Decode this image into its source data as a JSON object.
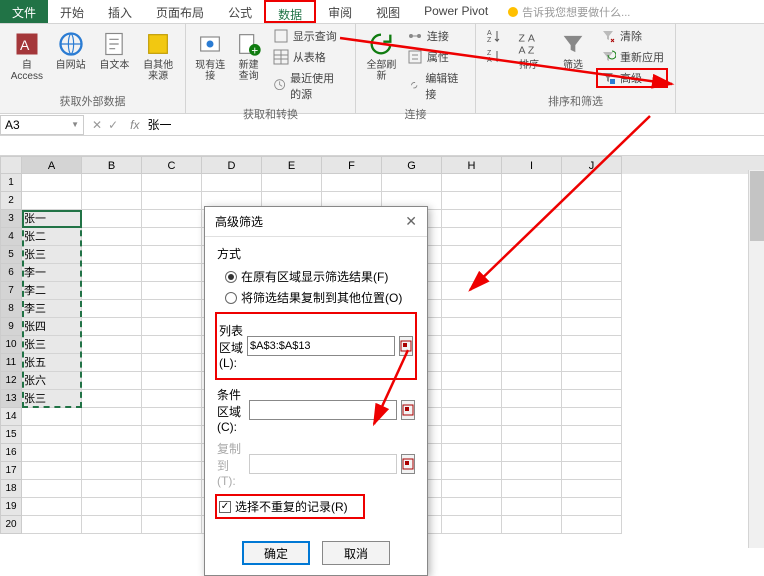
{
  "tabs": {
    "file": "文件",
    "home": "开始",
    "insert": "插入",
    "layout": "页面布局",
    "formula": "公式",
    "data": "数据",
    "review": "审阅",
    "view": "视图",
    "powerpivot": "Power Pivot",
    "tellme": "告诉我您想要做什么..."
  },
  "ribbon": {
    "access": "自 Access",
    "web": "自网站",
    "text": "自文本",
    "other": "自其他来源",
    "group1": "获取外部数据",
    "existing": "现有连接",
    "newquery": "新建\n查询",
    "showq": "显示查询",
    "fromtable": "从表格",
    "recent": "最近使用的源",
    "group2": "获取和转换",
    "refresh": "全部刷新",
    "connections": "连接",
    "properties": "属性",
    "editlinks": "编辑链接",
    "group3": "连接",
    "sortaz": "A→Z",
    "sortza": "Z→A",
    "sort": "排序",
    "filter": "筛选",
    "clear": "清除",
    "reapply": "重新应用",
    "advanced": "高级",
    "group4": "排序和筛选"
  },
  "namebox": "A3",
  "fx": "fx",
  "formula": "张一",
  "columns": [
    "A",
    "B",
    "C",
    "D",
    "E",
    "F",
    "G",
    "H",
    "I",
    "J"
  ],
  "row_data": {
    "3": "张一",
    "4": "张二",
    "5": "张三",
    "6": "李一",
    "7": "李二",
    "8": "李三",
    "9": "张四",
    "10": "张三",
    "11": "张五",
    "12": "张六",
    "13": "张三"
  },
  "dialog": {
    "title": "高级筛选",
    "method_label": "方式",
    "radio1": "在原有区域显示筛选结果(F)",
    "radio2": "将筛选结果复制到其他位置(O)",
    "list_label": "列表区域(L):",
    "list_value": "$A$3:$A$13",
    "criteria_label": "条件区域(C):",
    "criteria_value": "",
    "copyto_label": "复制到(T):",
    "copyto_value": "",
    "unique": "选择不重复的记录(R)",
    "ok": "确定",
    "cancel": "取消"
  }
}
